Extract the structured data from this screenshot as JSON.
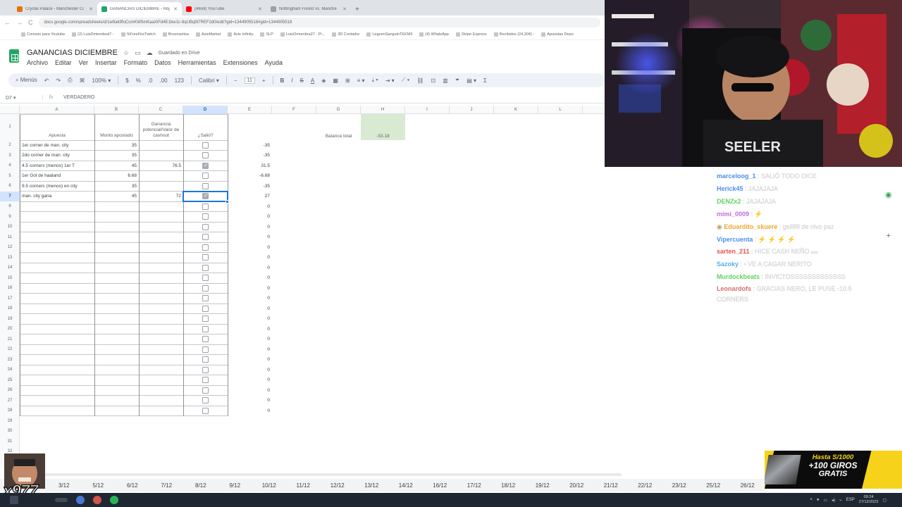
{
  "browser": {
    "tabs": [
      {
        "label": "Crystal Palace - Manchester Ci",
        "favicon_color": "#e8710a",
        "active": false
      },
      {
        "label": "GANANCIAS DICIEMBRE - Hoj",
        "favicon_color": "#23a566",
        "active": true
      },
      {
        "label": "(4659) YouTube",
        "favicon_color": "#ff0000",
        "active": false
      },
      {
        "label": "Nottingham Forest vs. Manche",
        "favicon_color": "#9aa0a6",
        "active": false
      }
    ],
    "new_tab": "+",
    "back": "←",
    "forward": "→",
    "reload": "C",
    "url": "docs.google.com/spreadsheets/d/1w9ak9fuCcmKW5mKaaXiFd4E1bw1c-8qUBq9t7REF2d0/edit?gid=1344905518#gid=1344905518",
    "bookmarks": [
      "Conseio para Youtube",
      "(2) LuisDmiembral7 -",
      "%FreeFireTwitch",
      "Bruenavitsa",
      "AxieMarket",
      "Axie Infinity",
      "SLP",
      "LuisOrmenbra27 - Pi...",
      "3D Contador",
      "LeguenSanguinTEKM3",
      "(4) WhatsApp",
      "Stripe Express",
      "Recibidos (24,304) -",
      "Apuestas Depo"
    ]
  },
  "sheets": {
    "title": "GANANCIAS DICIEMBRE",
    "saved_status": "Guardado en Drive",
    "menu": [
      "Archivo",
      "Editar",
      "Ver",
      "Insertar",
      "Formato",
      "Datos",
      "Herramientas",
      "Extensiones",
      "Ayuda"
    ],
    "toolbar": {
      "search_label": "Menús",
      "zoom": "100%",
      "currency": "$",
      "percent": "%",
      "decimals_less": ".0",
      "decimals_more": ".00",
      "format_123": "123",
      "font": "Calibri",
      "font_size": "11"
    },
    "name_box": "D7",
    "fx": "fx",
    "formula": "VERDADERO"
  },
  "grid": {
    "columns": [
      "A",
      "B",
      "C",
      "D",
      "E",
      "F",
      "G",
      "H",
      "I",
      "J",
      "K",
      "L"
    ],
    "selected_column": "D",
    "selected_row": 7,
    "headers": {
      "a": "Apuesta",
      "b": "Monto apostado",
      "c": "Ganancia potencial/Valor de cashout",
      "d": "¿Salió?",
      "g": "Balance total",
      "h": "-53.18"
    },
    "balance_fill": "#d9ead3",
    "rows": [
      {
        "a": "1er corner de man. city",
        "b": "35",
        "c": "",
        "d": false,
        "e": "-35"
      },
      {
        "a": "2do corner de man. city",
        "b": "35",
        "c": "",
        "d": false,
        "e": "-35"
      },
      {
        "a": "4.5 corners (menos) 1er T",
        "b": "45",
        "c": "76.5",
        "d": true,
        "e": "31.5"
      },
      {
        "a": "1er Gol de haaland",
        "b": "6.68",
        "c": "",
        "d": false,
        "e": "-6.68"
      },
      {
        "a": "9.5 corners (menos) en city",
        "b": "35",
        "c": "",
        "d": false,
        "e": "-35"
      },
      {
        "a": "man. city gana",
        "b": "45",
        "c": "72",
        "d": true,
        "e": "27"
      }
    ],
    "empty_row_value": "0",
    "row_numbers": [
      "1",
      "2",
      "3",
      "4",
      "5",
      "6",
      "7",
      "8",
      "9",
      "10",
      "11",
      "12",
      "13",
      "14",
      "15",
      "16",
      "17",
      "18",
      "19",
      "20",
      "21",
      "22",
      "23",
      "24",
      "25",
      "26",
      "27",
      "28",
      "29",
      "30",
      "31",
      "32"
    ]
  },
  "sheet_tabs": [
    "3/12",
    "5/12",
    "6/12",
    "7/12",
    "8/12",
    "9/12",
    "10/12",
    "11/12",
    "12/12",
    "13/12",
    "14/12",
    "16/12",
    "17/12",
    "18/12",
    "19/12",
    "20/12",
    "21/12",
    "22/12",
    "23/12",
    "25/12",
    "26/12"
  ],
  "chat": [
    {
      "user": "marceloog_1",
      "color": "#4f8ee8",
      "message": ": SALIÓ TODO DICE"
    },
    {
      "user": "Herick45",
      "color": "#4f8ee8",
      "message": ": JAJAJAJA"
    },
    {
      "user": "DENZx2",
      "color": "#5fd35a",
      "message": ": JAJAJAJA"
    },
    {
      "user": "mimi_0009",
      "color": "#c46bd8",
      "message": ": ⚡"
    },
    {
      "user": "Eduardito_skuere",
      "color": "#f0a52a",
      "message": ": gelllllll de nivo paz",
      "badge": true
    },
    {
      "user": "Vipercuenta",
      "color": "#4f8ee8",
      "message": ": ⚡ ⚡ ⚡ ⚡"
    },
    {
      "user": "sarten_211",
      "color": "#e8534f",
      "message": ": HICE CASH NEÑO ▬"
    },
    {
      "user": "Sazoky",
      "color": "#4fb2e8",
      "message": ": ▪ VE A CAGAR NERITO"
    },
    {
      "user": "Murdockbeats",
      "color": "#5fd35a",
      "message": ": INVICTOSSSSSSSSSSSSS"
    },
    {
      "user": "Leonardofs",
      "color": "#d86b6b",
      "message": ": GRACIAS NERO, LE PUSE -10.5 CORNERS"
    }
  ],
  "ad": {
    "line1": "Hasta S/1000",
    "line2": "+100 GIROS",
    "line3": "GRATIS"
  },
  "meme_label": "x977",
  "taskbar": {
    "language": "ESP",
    "time": "09:24",
    "date": "27/12/2023"
  }
}
